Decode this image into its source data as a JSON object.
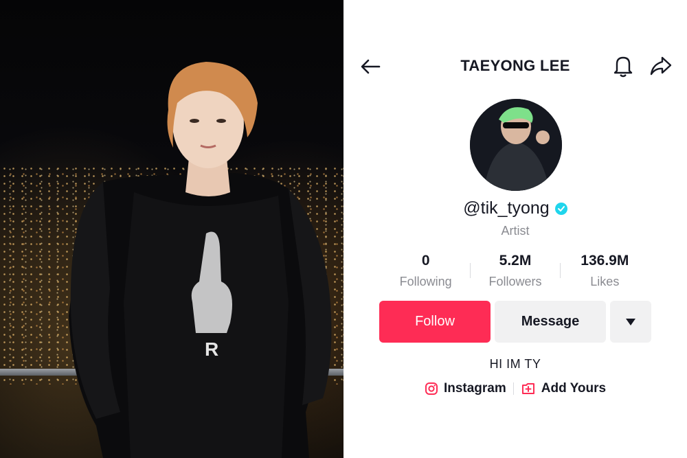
{
  "profile": {
    "title": "TAEYONG LEE",
    "handle": "@tik_tyong",
    "category": "Artist",
    "bio": "HI IM TY"
  },
  "stats": [
    {
      "value": "0",
      "label": "Following"
    },
    {
      "value": "5.2M",
      "label": "Followers"
    },
    {
      "value": "136.9M",
      "label": "Likes"
    }
  ],
  "actions": {
    "follow_label": "Follow",
    "message_label": "Message"
  },
  "links": {
    "instagram_label": "Instagram",
    "add_yours_label": "Add Yours"
  },
  "icons": {
    "back": "back-arrow-icon",
    "bell": "bell-icon",
    "share": "share-icon",
    "verified": "verified-badge-icon",
    "dropdown": "caret-down-icon",
    "instagram": "instagram-icon",
    "add_yours": "add-yours-icon"
  },
  "colors": {
    "follow_button": "#fe2c55",
    "verified_badge": "#20d5ec",
    "link_icon": "#fe2c55"
  }
}
